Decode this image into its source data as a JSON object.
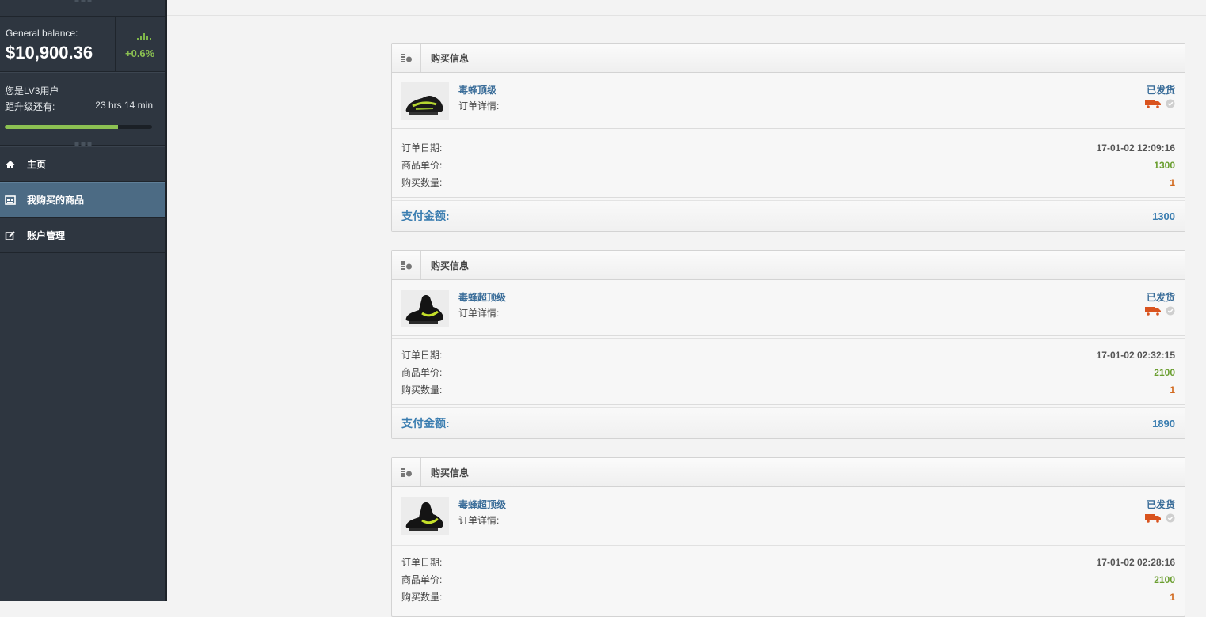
{
  "sidebar": {
    "balance_label": "General balance:",
    "balance_value": "$10,900.36",
    "balance_change": "+0.6%",
    "level_text": "您是LV3用户",
    "upgrade_label": "距升级还有:",
    "upgrade_time": "23 hrs 14 min",
    "upgrade_progress": 0.77,
    "nav": [
      {
        "label": "主页",
        "icon": "home-icon"
      },
      {
        "label": "我购买的商品",
        "icon": "store-icon",
        "active": true
      },
      {
        "label": "账户管理",
        "icon": "edit-icon"
      }
    ]
  },
  "labels": {
    "card_title": "购买信息",
    "order_detail": "订单详情:",
    "order_date": "订单日期:",
    "unit_price": "商品单价:",
    "quantity": "购买数量:",
    "payment": "支付金额:"
  },
  "orders": [
    {
      "name": "毒蜂顶级",
      "status": "已发货",
      "date": "17-01-02 12:09:16",
      "price": "1300",
      "qty": "1",
      "total": "1300"
    },
    {
      "name": "毒蜂超顶级",
      "status": "已发货",
      "date": "17-01-02 02:32:15",
      "price": "2100",
      "qty": "1",
      "total": "1890"
    },
    {
      "name": "毒蜂超顶级",
      "status": "已发货",
      "date": "17-01-02 02:28:16",
      "price": "2100",
      "qty": "1",
      "total": ""
    }
  ],
  "colors": {
    "sidebar_bg": "#2e3640",
    "nav_active": "#4c6b84",
    "accent_green": "#8cc152",
    "link_blue": "#3a6d99",
    "qty_orange": "#d2691e",
    "truck_orange": "#d9531e"
  }
}
